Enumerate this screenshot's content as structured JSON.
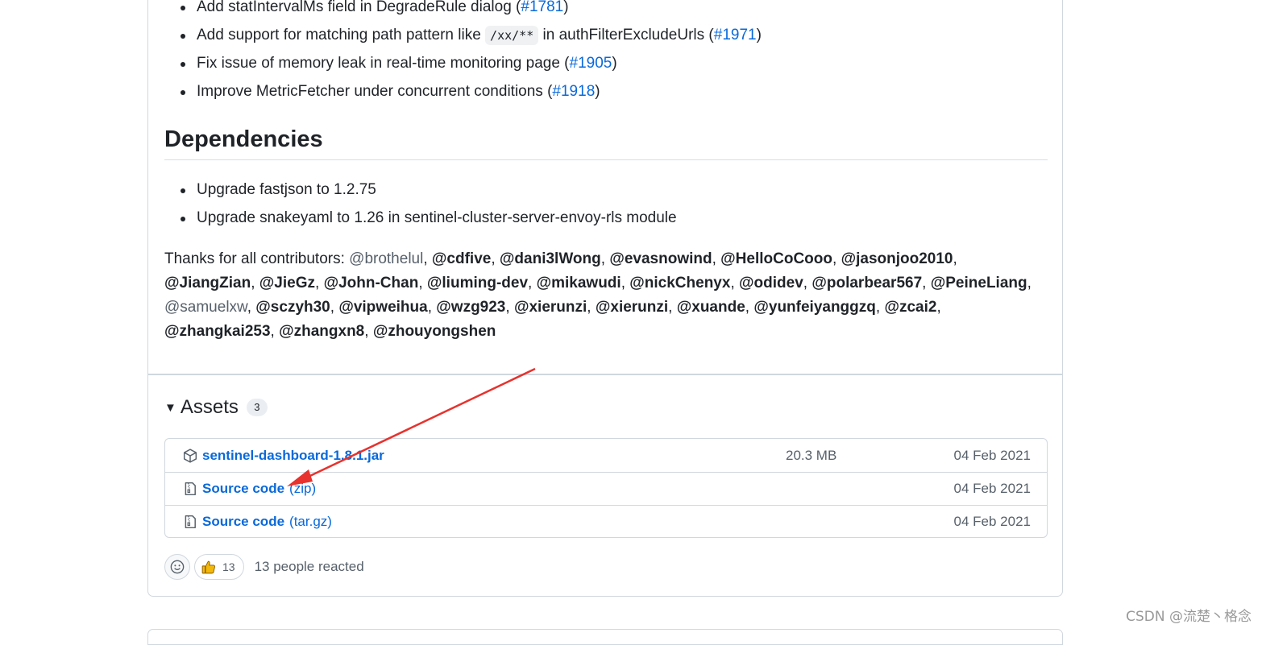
{
  "top_list": [
    {
      "text": "Add statIntervalMs field in DegradeRule dialog (",
      "link": "#1781",
      "after": ")"
    },
    {
      "text": "Add support for matching path pattern like ",
      "code": "/xx/**",
      "text2": " in authFilterExcludeUrls (",
      "link": "#1971",
      "after": ")"
    },
    {
      "text": "Fix issue of memory leak in real-time monitoring page (",
      "link": "#1905",
      "after": ")"
    },
    {
      "text": "Improve MetricFetcher under concurrent conditions (",
      "link": "#1918",
      "after": ")"
    }
  ],
  "dependencies": {
    "title": "Dependencies",
    "items": [
      "Upgrade fastjson to 1.2.75",
      "Upgrade snakeyaml to 1.26 in sentinel-cluster-server-envoy-rls module"
    ]
  },
  "thanks": {
    "prefix": "Thanks for all contributors: ",
    "contributors": [
      {
        "name": "@brothelul",
        "bold": false
      },
      {
        "name": "@cdfive",
        "bold": true
      },
      {
        "name": "@dani3lWong",
        "bold": true
      },
      {
        "name": "@evasnowind",
        "bold": true
      },
      {
        "name": "@HelloCoCooo",
        "bold": true
      },
      {
        "name": "@jasonjoo2010",
        "bold": true
      },
      {
        "name": "@JiangZian",
        "bold": true
      },
      {
        "name": "@JieGz",
        "bold": true
      },
      {
        "name": "@John-Chan",
        "bold": true
      },
      {
        "name": "@liuming-dev",
        "bold": true
      },
      {
        "name": "@mikawudi",
        "bold": true
      },
      {
        "name": "@nickChenyx",
        "bold": true
      },
      {
        "name": "@odidev",
        "bold": true
      },
      {
        "name": "@polarbear567",
        "bold": true
      },
      {
        "name": "@PeineLiang",
        "bold": true
      },
      {
        "name": "@samuelxw",
        "bold": false
      },
      {
        "name": "@sczyh30",
        "bold": true
      },
      {
        "name": "@vipweihua",
        "bold": true
      },
      {
        "name": "@wzg923",
        "bold": true
      },
      {
        "name": "@xierunzi",
        "bold": true
      },
      {
        "name": "@xierunzi",
        "bold": true
      },
      {
        "name": "@xuande",
        "bold": true
      },
      {
        "name": "@yunfeiyanggzq",
        "bold": true
      },
      {
        "name": "@zcai2",
        "bold": true
      },
      {
        "name": "@zhangkai253",
        "bold": true
      },
      {
        "name": "@zhangxn8",
        "bold": true
      },
      {
        "name": "@zhouyongshen",
        "bold": true
      }
    ]
  },
  "assets": {
    "title": "Assets",
    "count": "3",
    "items": [
      {
        "name": "sentinel-dashboard-1.8.1.jar",
        "ext": "",
        "size": "20.3 MB",
        "date": "04 Feb 2021",
        "icon": "package-icon"
      },
      {
        "name": "Source code",
        "ext": "(zip)",
        "size": "",
        "date": "04 Feb 2021",
        "icon": "file-zip-icon"
      },
      {
        "name": "Source code",
        "ext": "(tar.gz)",
        "size": "",
        "date": "04 Feb 2021",
        "icon": "file-zip-icon"
      }
    ]
  },
  "reactions": {
    "thumbs_count": "13",
    "summary": "13 people reacted"
  },
  "watermark": "CSDN @流楚丶格念",
  "colors": {
    "link": "#0969da",
    "arrow": "#e8322d",
    "border": "#d0d7de"
  }
}
